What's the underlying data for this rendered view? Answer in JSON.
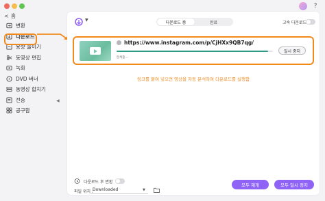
{
  "titlebar": {
    "help_icon": "?"
  },
  "back": {
    "arrow": "<",
    "label": "홈"
  },
  "sidebar": {
    "items": [
      {
        "label": "변환",
        "icon": "convert-icon"
      },
      {
        "label": "다운로드",
        "icon": "download-icon",
        "active": true
      },
      {
        "label": "용량 줄이기",
        "icon": "compress-icon"
      },
      {
        "label": "동영상 편집",
        "icon": "edit-icon"
      },
      {
        "label": "녹화",
        "icon": "record-icon"
      },
      {
        "label": "DVD 버너",
        "icon": "dvd-icon"
      },
      {
        "label": "동영상 합치기",
        "icon": "merge-icon"
      },
      {
        "label": "전송",
        "icon": "transfer-icon"
      },
      {
        "label": "공구함",
        "icon": "toolbox-icon"
      }
    ],
    "collapse_arrow": "◀"
  },
  "main": {
    "tabs": [
      {
        "label": "다운로드 중",
        "active": true
      },
      {
        "label": "완료",
        "active": false
      }
    ],
    "high_speed_label": "고속 다운로드",
    "card": {
      "url": "https://www.instagram.com/p/CjHXx9QB7qg/",
      "status": "분석중...",
      "progress": 0.97,
      "pause_button": "일시 중지"
    },
    "hint": "링크를 붙여 넣으면 영상을 자동 분석하여 다운로드를 실행함",
    "footer": {
      "convert_after_label": "다운로드 후 변환",
      "file_location_label": "파일 위치 :",
      "file_location_value": "Downloaded",
      "resume_all": "모두 재개",
      "pause_all": "모두 일시 정지"
    }
  },
  "colors": {
    "accent": "#8e63f5",
    "highlight": "#f08a1d",
    "progress": "#2b9a86"
  }
}
